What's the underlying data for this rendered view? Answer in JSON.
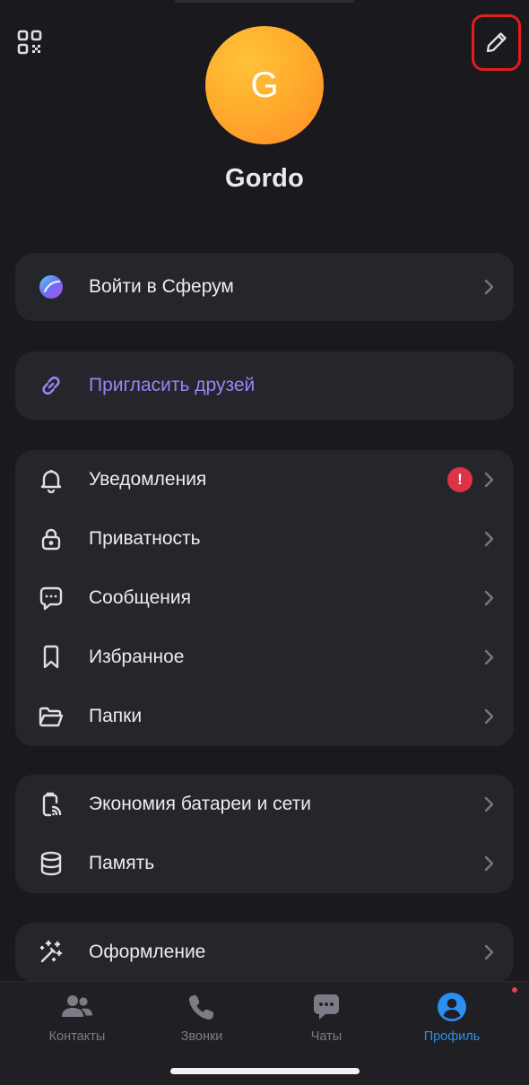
{
  "profile": {
    "avatar_letter": "G",
    "name": "Gordo"
  },
  "sferum": {
    "label": "Войти в Сферум"
  },
  "invite": {
    "label": "Пригласить друзей"
  },
  "settings": [
    {
      "label": "Уведомления",
      "icon": "bell-icon",
      "alert": "!"
    },
    {
      "label": "Приватность",
      "icon": "lock-icon"
    },
    {
      "label": "Сообщения",
      "icon": "message-icon"
    },
    {
      "label": "Избранное",
      "icon": "bookmark-icon"
    },
    {
      "label": "Папки",
      "icon": "folder-icon"
    }
  ],
  "system": [
    {
      "label": "Экономия батареи и сети",
      "icon": "battery-saver-icon"
    },
    {
      "label": "Память",
      "icon": "database-icon"
    }
  ],
  "appearance": {
    "label": "Оформление",
    "icon": "magic-wand-icon"
  },
  "tabs": [
    {
      "label": "Контакты",
      "icon": "contacts-icon"
    },
    {
      "label": "Звонки",
      "icon": "phone-icon"
    },
    {
      "label": "Чаты",
      "icon": "chat-icon"
    },
    {
      "label": "Профиль",
      "icon": "profile-icon",
      "active": true
    }
  ],
  "colors": {
    "background": "#19191e",
    "card": "#25252c",
    "accent": "#9b84f5",
    "active_tab": "#2b8ef1",
    "alert": "#dd3347"
  }
}
